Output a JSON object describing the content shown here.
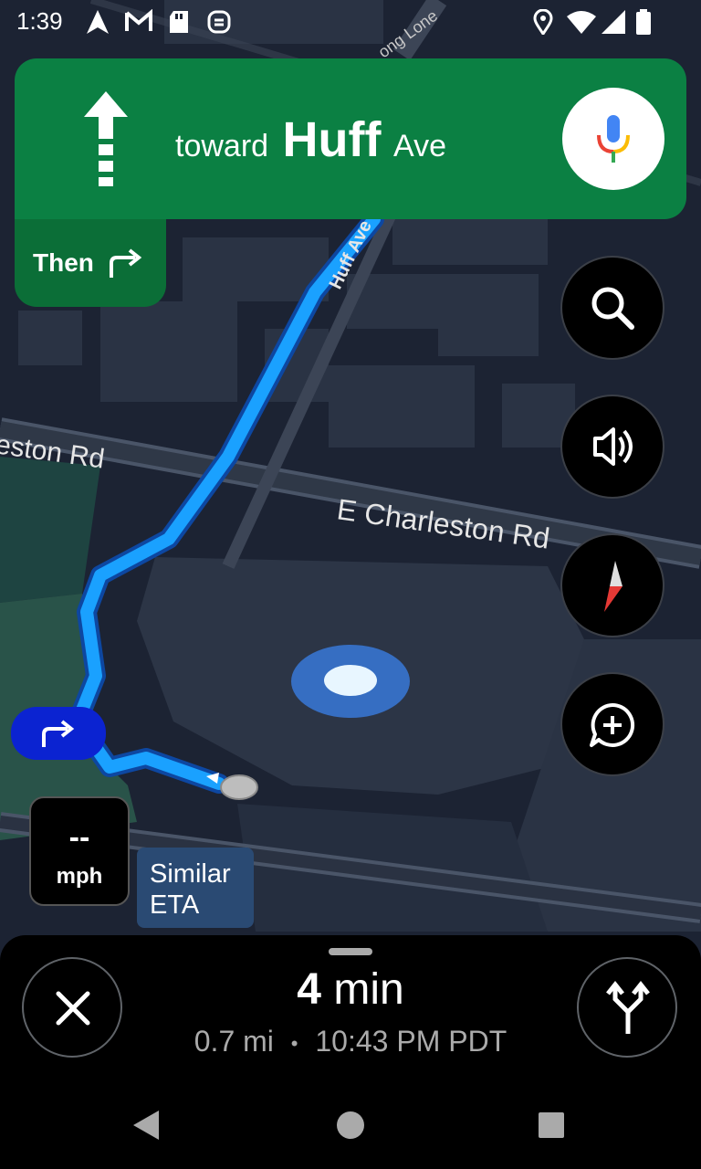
{
  "status_bar": {
    "time": "1:39",
    "icons": [
      "navigation-arrow-icon",
      "gmail-icon",
      "sd-card-icon",
      "sync-icon",
      "location-pin-icon",
      "wifi-icon",
      "cell-signal-icon",
      "battery-icon"
    ]
  },
  "direction": {
    "maneuver_icon": "straight-arrow-icon",
    "prefix": "toward",
    "street": "Huff",
    "suffix": "Ave",
    "mic_icon": "google-mic-icon"
  },
  "next_step": {
    "label": "Then",
    "icon": "turn-right-icon"
  },
  "map": {
    "labels": {
      "huff": "Huff Ave",
      "charleston_left": "eston Rd",
      "charleston_main": "E Charleston Rd",
      "top_road": "ong Lone"
    },
    "route_color": "#1aa1ff",
    "location_color": "#3878d8"
  },
  "side_buttons": [
    "search-icon",
    "volume-icon",
    "compass-icon",
    "add-report-icon"
  ],
  "turn_badge_icon": "turn-right-icon",
  "speed": {
    "value": "--",
    "unit": "mph"
  },
  "eta_tag": {
    "line1": "Similar",
    "line2": "ETA"
  },
  "trip": {
    "duration_num": "4",
    "duration_unit": "min",
    "distance": "0.7 mi",
    "separator": "•",
    "arrival": "10:43 PM PDT",
    "close_icon": "close-icon",
    "alternates_icon": "alternate-routes-icon"
  },
  "nav_bar": [
    "back-icon",
    "home-icon",
    "recents-icon"
  ]
}
